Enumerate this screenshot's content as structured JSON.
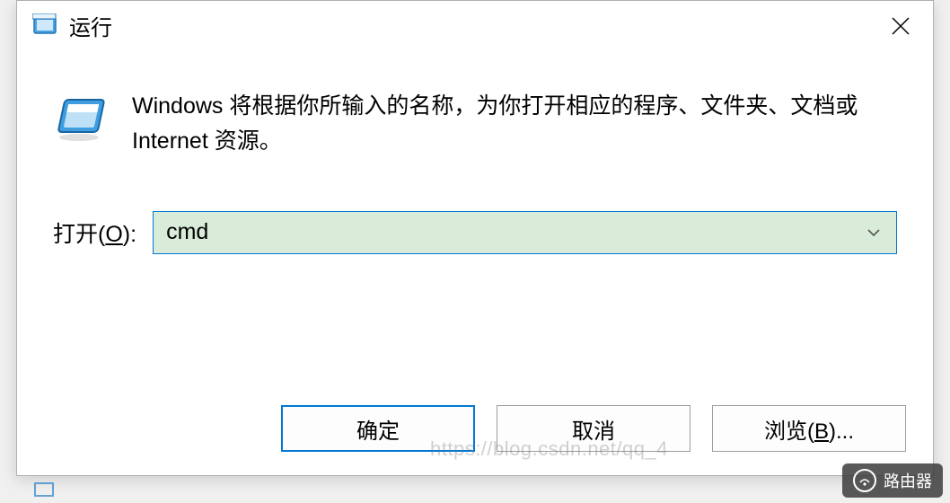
{
  "dialog": {
    "title": "运行",
    "description": "Windows 将根据你所输入的名称，为你打开相应的程序、文件夹、文档或 Internet 资源。",
    "open_label_prefix": "打开(",
    "open_label_key": "O",
    "open_label_suffix": "):",
    "input_value": "cmd",
    "buttons": {
      "ok": "确定",
      "cancel": "取消",
      "browse_prefix": "浏览(",
      "browse_key": "B",
      "browse_suffix": ")..."
    }
  },
  "watermark": "https://blog.csdn.net/qq_4",
  "footer_badge": "路由器"
}
